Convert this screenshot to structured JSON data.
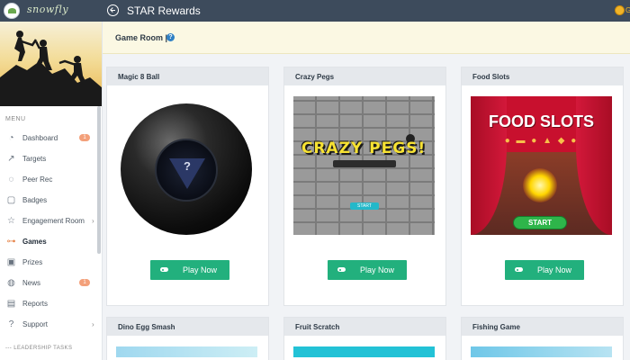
{
  "app": {
    "logo_text": "snowfly",
    "title": "STAR Rewards",
    "coin_letter": "G"
  },
  "sidebar": {
    "menu_label": "MENU",
    "items": [
      {
        "label": "Dashboard",
        "icon": "dashboard-icon",
        "badge": "1"
      },
      {
        "label": "Targets",
        "icon": "chart-trend-icon"
      },
      {
        "label": "Peer Rec",
        "icon": "chat-icon"
      },
      {
        "label": "Badges",
        "icon": "badge-icon"
      },
      {
        "label": "Engagement Room",
        "icon": "star-icon"
      },
      {
        "label": "Games",
        "icon": "gamepad-icon",
        "active": true
      },
      {
        "label": "Prizes",
        "icon": "gift-icon"
      },
      {
        "label": "News",
        "icon": "globe-icon",
        "badge": "1"
      },
      {
        "label": "Reports",
        "icon": "document-icon"
      },
      {
        "label": "Support",
        "icon": "help-circle-icon"
      }
    ],
    "leadership_label": "LEADERSHIP TASKS"
  },
  "content": {
    "title": "Game Room |",
    "help_glyph": "?"
  },
  "games": [
    {
      "title": "Magic 8 Ball",
      "play_label": "Play Now"
    },
    {
      "title": "Crazy Pegs",
      "play_label": "Play Now",
      "logo": "CRAZY PEGS!",
      "start": "START"
    },
    {
      "title": "Food Slots",
      "play_label": "Play Now",
      "logo": "FOOD SLOTS",
      "start": "START"
    },
    {
      "title": "Dino Egg Smash"
    },
    {
      "title": "Fruit Scratch"
    },
    {
      "title": "Fishing Game"
    }
  ],
  "colors": {
    "topbar": "#3d4b5c",
    "play_button": "#22b07d",
    "header_bg": "#fbf8e3",
    "badge": "#f3a07a",
    "active_icon": "#e6844a"
  }
}
